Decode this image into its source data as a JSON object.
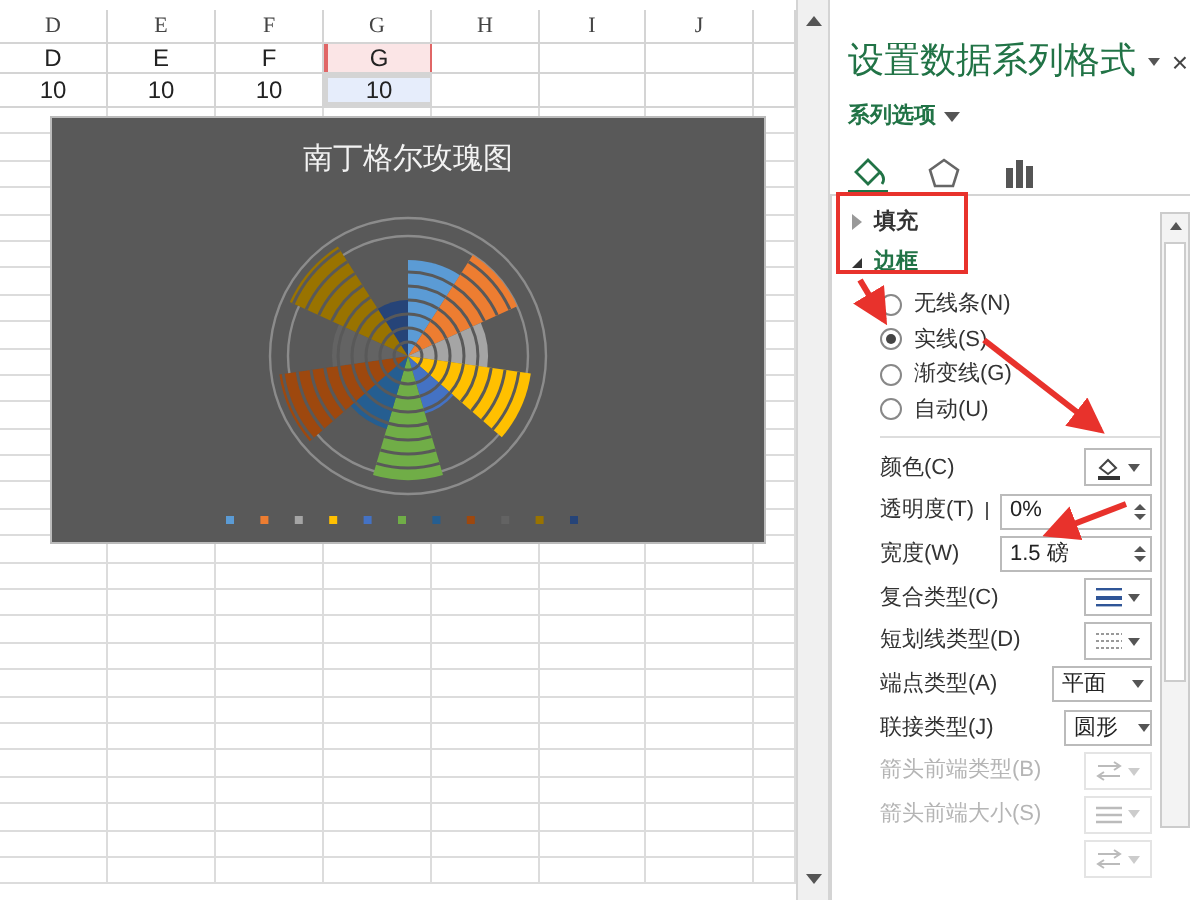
{
  "sheet": {
    "column_headers": [
      "D",
      "E",
      "F",
      "G",
      "H",
      "I",
      "J"
    ],
    "rows": [
      [
        {
          "text": "D",
          "kind": "plain"
        },
        {
          "text": "E",
          "kind": "plain"
        },
        {
          "text": "F",
          "kind": "plain"
        },
        {
          "text": "G",
          "kind": "series-name"
        }
      ],
      [
        {
          "text": "10",
          "kind": "plain"
        },
        {
          "text": "10",
          "kind": "plain"
        },
        {
          "text": "10",
          "kind": "plain"
        },
        {
          "text": "10",
          "kind": "values"
        }
      ]
    ]
  },
  "chart": {
    "title": "南丁格尔玫瑰图",
    "legend": [
      {
        "color": "#5b9bd5"
      },
      {
        "color": "#ed7d31"
      },
      {
        "color": "#a5a5a5"
      },
      {
        "color": "#ffc000"
      },
      {
        "color": "#4472c4"
      },
      {
        "color": "#70ad47"
      },
      {
        "color": "#255e91"
      },
      {
        "color": "#9e480e"
      },
      {
        "color": "#636363"
      },
      {
        "color": "#997300"
      },
      {
        "color": "#264478"
      }
    ]
  },
  "pane": {
    "title": "设置数据系列格式",
    "close": "×",
    "options_menu": "系列选项",
    "tabs": [
      {
        "selected": true
      },
      {
        "selected": false
      },
      {
        "selected": false
      }
    ],
    "groups": [
      {
        "label": "填充",
        "expanded": false
      },
      {
        "label": "边框",
        "expanded": true
      }
    ],
    "radios": [
      {
        "label": "无线条(N)",
        "selected": false
      },
      {
        "label": "实线(S)",
        "selected": true
      },
      {
        "label": "渐变线(G)",
        "selected": false
      },
      {
        "label": "自动(U)",
        "selected": false
      }
    ],
    "rows": [
      {
        "kind": "color",
        "label": "颜色(C)",
        "disabled": false
      },
      {
        "kind": "slider-spin",
        "label": "透明度(T)",
        "value": "0%",
        "disabled": false
      },
      {
        "kind": "spin",
        "label": "宽度(W)",
        "value": "1.5 磅",
        "disabled": false
      },
      {
        "kind": "compound",
        "label": "复合类型(C)",
        "disabled": false
      },
      {
        "kind": "dash",
        "label": "短划线类型(D)",
        "disabled": false
      },
      {
        "kind": "dropdown",
        "label": "端点类型(A)",
        "value": "平面",
        "disabled": false
      },
      {
        "kind": "dropdown",
        "label": "联接类型(J)",
        "value": "圆形",
        "disabled": false
      },
      {
        "kind": "arrow-type",
        "label": "箭头前端类型(B)",
        "disabled": true
      },
      {
        "kind": "arrow-size",
        "label": "箭头前端大小(S)",
        "disabled": true
      }
    ]
  }
}
